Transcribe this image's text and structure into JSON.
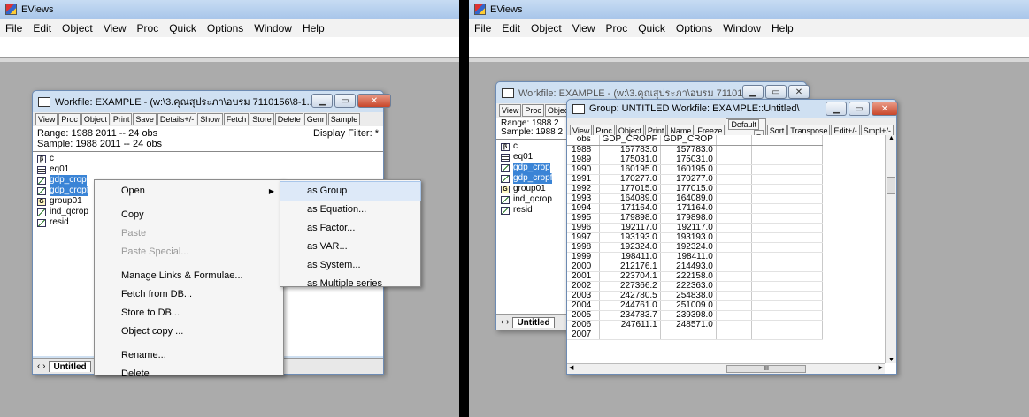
{
  "app": {
    "title": "EViews",
    "menu": [
      "File",
      "Edit",
      "Object",
      "View",
      "Proc",
      "Quick",
      "Options",
      "Window",
      "Help"
    ]
  },
  "workfile": {
    "title": "Workfile: EXAMPLE - (w:\\3.คุณสุประภา\\อบรม 7110156\\8-1...",
    "toolbar": [
      "View",
      "Proc",
      "Object",
      "Print",
      "Save",
      "Details+/-",
      "Show",
      "Fetch",
      "Store",
      "Delete",
      "Genr",
      "Sample"
    ],
    "range": "Range:  1988 2011  --  24 obs",
    "sample": "Sample: 1988 2011  --  24 obs",
    "display_filter": "Display Filter: *",
    "objects": [
      {
        "name": "c",
        "icon": "coef-icon",
        "selected": false
      },
      {
        "name": "eq01",
        "icon": "equation-icon",
        "selected": false
      },
      {
        "name": "gdp_crop",
        "icon": "series-icon",
        "selected": true
      },
      {
        "name": "gdp_cropf",
        "icon": "series-icon",
        "selected": true
      },
      {
        "name": "group01",
        "icon": "group-icon",
        "selected": false
      },
      {
        "name": "ind_qcrop",
        "icon": "series-icon",
        "selected": false
      },
      {
        "name": "resid",
        "icon": "series-icon",
        "selected": false
      }
    ],
    "tab": "Untitled",
    "right_title": "Workfile: EXAMPLE - (w:\\3.คุณสุประภา\\อบรม 7110156\\8-1...",
    "right_range": "Range:  1988 2",
    "right_sample": "Sample: 1988 2"
  },
  "context_menu": {
    "items": [
      {
        "label": "Open",
        "submenu": true,
        "disabled": false
      },
      {
        "sep": true
      },
      {
        "label": "Copy",
        "disabled": false
      },
      {
        "label": "Paste",
        "disabled": true
      },
      {
        "label": "Paste Special...",
        "disabled": true
      },
      {
        "sep": true
      },
      {
        "label": "Manage Links & Formulae...",
        "disabled": false
      },
      {
        "label": "Fetch from DB...",
        "disabled": false
      },
      {
        "label": "Store to DB...",
        "disabled": false
      },
      {
        "label": "Object copy ...",
        "disabled": false
      },
      {
        "sep": true
      },
      {
        "label": "Rename...",
        "disabled": false
      },
      {
        "label": "Delete",
        "disabled": false
      }
    ],
    "submenu": [
      "as Group",
      "as Equation...",
      "as Factor...",
      "as VAR...",
      "as System...",
      "as Multiple series"
    ]
  },
  "group": {
    "title": "Group: UNTITLED   Workfile: EXAMPLE::Untitled\\",
    "toolbar": [
      "View",
      "Proc",
      "Object",
      "Print",
      "Name",
      "Freeze"
    ],
    "format_select": "Default",
    "toolbar2": [
      "Sort",
      "Transpose",
      "Edit+/-",
      "Smpl+/-"
    ],
    "columns": [
      "obs",
      "GDP_CROPF",
      "GDP_CROP"
    ],
    "rows": [
      [
        "1988",
        "157783.0",
        "157783.0"
      ],
      [
        "1989",
        "175031.0",
        "175031.0"
      ],
      [
        "1990",
        "160195.0",
        "160195.0"
      ],
      [
        "1991",
        "170277.0",
        "170277.0"
      ],
      [
        "1992",
        "177015.0",
        "177015.0"
      ],
      [
        "1993",
        "164089.0",
        "164089.0"
      ],
      [
        "1994",
        "171164.0",
        "171164.0"
      ],
      [
        "1995",
        "179898.0",
        "179898.0"
      ],
      [
        "1996",
        "192117.0",
        "192117.0"
      ],
      [
        "1997",
        "193193.0",
        "193193.0"
      ],
      [
        "1998",
        "192324.0",
        "192324.0"
      ],
      [
        "1999",
        "198411.0",
        "198411.0"
      ],
      [
        "2000",
        "212176.1",
        "214493.0"
      ],
      [
        "2001",
        "223704.1",
        "222158.0"
      ],
      [
        "2002",
        "227366.2",
        "222363.0"
      ],
      [
        "2003",
        "242780.5",
        "254838.0"
      ],
      [
        "2004",
        "244761.0",
        "251009.0"
      ],
      [
        "2005",
        "234783.7",
        "239398.0"
      ],
      [
        "2006",
        "247611.1",
        "248571.0"
      ],
      [
        "2007",
        "",
        ""
      ]
    ],
    "hscroll_label": "III"
  }
}
